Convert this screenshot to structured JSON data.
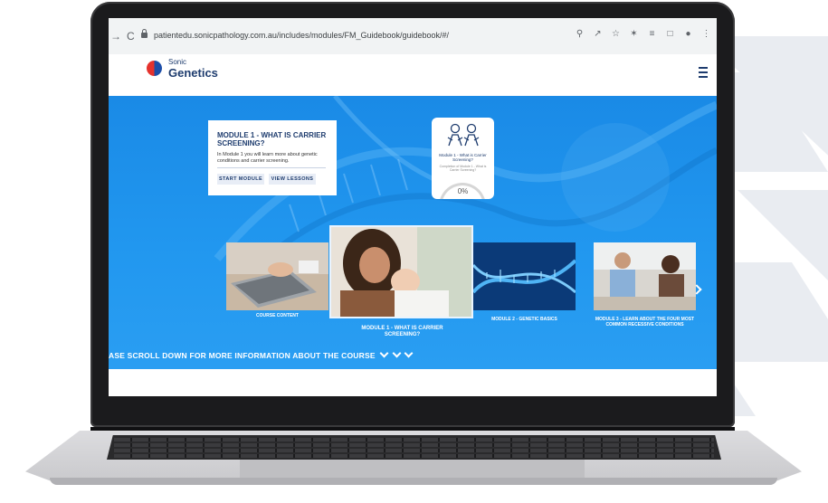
{
  "browser": {
    "url": "patientedu.sonicpathology.com.au/includes/modules/FM_Guidebook/guidebook/#/",
    "back_glyph": "→",
    "reload_glyph": "C",
    "toolbar_icons": [
      "search-icon",
      "share-icon",
      "star-icon",
      "extensions-icon",
      "reading-list-icon",
      "sidebar-icon",
      "profile-icon",
      "menu-icon"
    ]
  },
  "site": {
    "brand_top": "Sonic",
    "brand_bottom": "Genetics"
  },
  "module_card": {
    "title": "MODULE 1 - WHAT IS CARRIER SCREENING?",
    "description": "In Module 1 you will learn more about genetic conditions and carrier screening.",
    "start_label": "START MODULE",
    "view_label": "VIEW LESSONS"
  },
  "progress_card": {
    "title": "Module 1 - What is Carrier Screening?",
    "subtitle": "Completion of Module 1 - What is Carrier Screening?",
    "percent_label": "0%",
    "percent": 0
  },
  "carousel": {
    "tiles": [
      {
        "label": "COURSE CONTENT"
      },
      {
        "label": "MODULE 1 - WHAT IS CARRIER SCREENING?"
      },
      {
        "label": "MODULE 2 - GENETIC BASICS"
      },
      {
        "label": "MODULE 3 - LEARN ABOUT THE FOUR MOST COMMON RECESSIVE CONDITIONS"
      }
    ]
  },
  "scroll_hint": "ASE SCROLL DOWN FOR MORE INFORMATION ABOUT THE COURSE",
  "colors": {
    "hero_blue": "#1a8ae6",
    "brand_navy": "#1e3c6e",
    "logo_red": "#e5322d"
  }
}
